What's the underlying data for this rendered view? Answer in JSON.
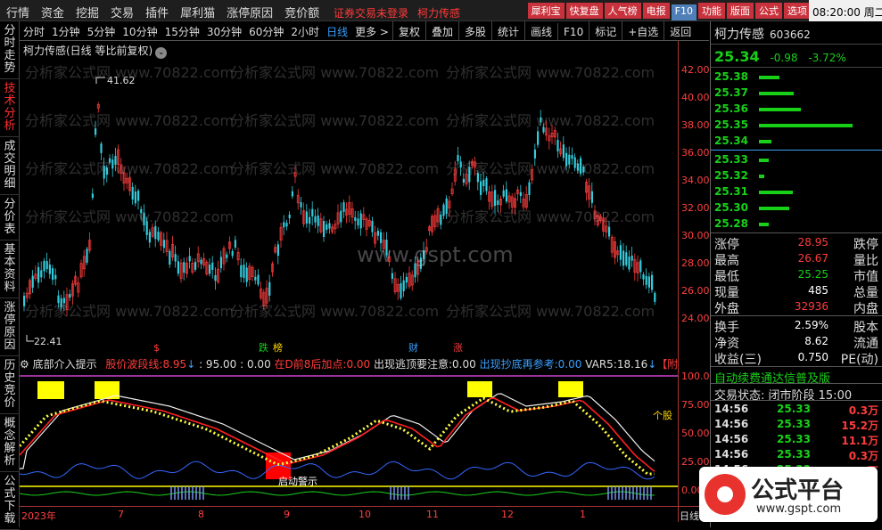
{
  "menubar": {
    "items": [
      "行情",
      "资金",
      "挖掘",
      "交易",
      "插件",
      "犀利猫",
      "涨停原因",
      "竞价额"
    ],
    "notice1": "证券交易未登录",
    "notice2": "柯力传感",
    "buttons": [
      "犀利宝",
      "快复盘",
      "人气榜",
      "电报",
      "F10",
      "功能",
      "版面",
      "公式",
      "选项"
    ],
    "clock": "08:20:00 周二"
  },
  "leftnav": [
    "分时走势",
    "技术分析",
    "成交明细",
    "分价表",
    "基本资料",
    "涨停原因",
    "历史竞价",
    "概念解析",
    "公式下载"
  ],
  "period_tabs": [
    "分时",
    "1分钟",
    "5分钟",
    "10分钟",
    "15分钟",
    "30分钟",
    "60分钟",
    "2小时",
    "日线",
    "更多 >"
  ],
  "tool_tabs": [
    "复权",
    "叠加",
    "多股",
    "统计",
    "画线",
    "F10",
    "标记",
    "+自选",
    "返回"
  ],
  "chart_title": "柯力传感(日线 等比前复权)",
  "chart_title_icon": "chevron-down-icon",
  "watermark_small": "分析家公式网 www.70822.com",
  "watermark_big": "www.gspt.com",
  "price_high_label": "41.62",
  "price_low_label": "22.41",
  "event_markers": [
    {
      "text": "$",
      "color": "#ff3c3c"
    },
    {
      "text": "跌",
      "color": "#18d018"
    },
    {
      "text": "榜",
      "color": "#ffd700"
    },
    {
      "text": "财",
      "color": "#3aa0ff"
    },
    {
      "text": "涨",
      "color": "#ff3c3c"
    }
  ],
  "y_axis_main": [
    "42.00",
    "40.00",
    "38.00",
    "36.00",
    "34.00",
    "32.00",
    "30.00",
    "28.00",
    "26.00",
    "24.00"
  ],
  "y_axis_ind": [
    "100.0",
    "75.00",
    "50.00",
    "25.00",
    "0.000"
  ],
  "indicator_bar": {
    "name": "底部介入提示",
    "l1": "股价波段线:",
    "v1": "8.95",
    "arrow1": "↓",
    "v2": ": 95.00",
    "v3": ": 0.00",
    "l2": "在D前8后加点:",
    "v4": "0.00",
    "l3": "出现逃顶要注意:",
    "v5": "0.00",
    "l4": "出现抄底再参考:",
    "v6": "0.00",
    "l5": "VAR5:",
    "v7": "18.16",
    "arrow2": "↓",
    "tail": "【附"
  },
  "ind_annotation": "启动警示",
  "ind_side_label": "个股",
  "x_axis": [
    "2023年",
    "7",
    "8",
    "9",
    "10",
    "11",
    "12",
    "1"
  ],
  "x_axis_period": "日线",
  "stock": {
    "name": "柯力传感",
    "code": "603662",
    "price": "25.34",
    "change": "-0.98",
    "pct": "-3.72%"
  },
  "orderbook_sell": [
    {
      "price": "25.38",
      "level": 0.22
    },
    {
      "price": "25.37",
      "level": 0.37
    },
    {
      "price": "25.36",
      "level": 0.45
    },
    {
      "price": "25.35",
      "level": 1.0
    },
    {
      "price": "25.34",
      "level": 0.13
    }
  ],
  "orderbook_buy": [
    {
      "price": "25.33",
      "level": 0.1
    },
    {
      "price": "25.32",
      "level": 0.06
    },
    {
      "price": "25.31",
      "level": 0.36
    },
    {
      "price": "25.30",
      "level": 0.32
    },
    {
      "price": "25.28",
      "level": 0.1
    }
  ],
  "stats": [
    {
      "k": "涨停",
      "v": "28.95",
      "vc": "red",
      "k2": "跌停"
    },
    {
      "k": "最高",
      "v": "26.67",
      "vc": "red",
      "k2": "量比"
    },
    {
      "k": "最低",
      "v": "25.25",
      "vc": "green",
      "k2": "市值"
    },
    {
      "k": "现量",
      "v": "485",
      "vc": "white",
      "k2": "总量"
    },
    {
      "k": "外盘",
      "v": "32936",
      "vc": "red",
      "k2": "内盘"
    },
    {
      "k": "换手",
      "v": "2.59%",
      "vc": "white",
      "k2": "股本"
    },
    {
      "k": "净资",
      "v": "8.62",
      "vc": "white",
      "k2": "流通"
    },
    {
      "k": "收益(三)",
      "v": "0.750",
      "vc": "white",
      "k2": "PE(动)"
    }
  ],
  "promo": "自动续费通达信普及版",
  "trade_status": "交易状态: 闭市阶段 15:00",
  "trades": [
    {
      "time": "14:56",
      "price": "25.33",
      "vol": "0.3万"
    },
    {
      "time": "14:56",
      "price": "25.33",
      "vol": "15.2万"
    },
    {
      "time": "14:56",
      "price": "25.33",
      "vol": "11.1万"
    },
    {
      "time": "14:56",
      "price": "25.33",
      "vol": "0.3万"
    },
    {
      "time": "14:56",
      "price": "25.33",
      "vol": "0.3万"
    }
  ],
  "logo": {
    "title": "公式平台",
    "url": "www.gspt.com"
  },
  "colors": {
    "up": "#ff3c3c",
    "down": "#18d018",
    "accent": "#3aa0ff",
    "frame": "#aa3333"
  }
}
